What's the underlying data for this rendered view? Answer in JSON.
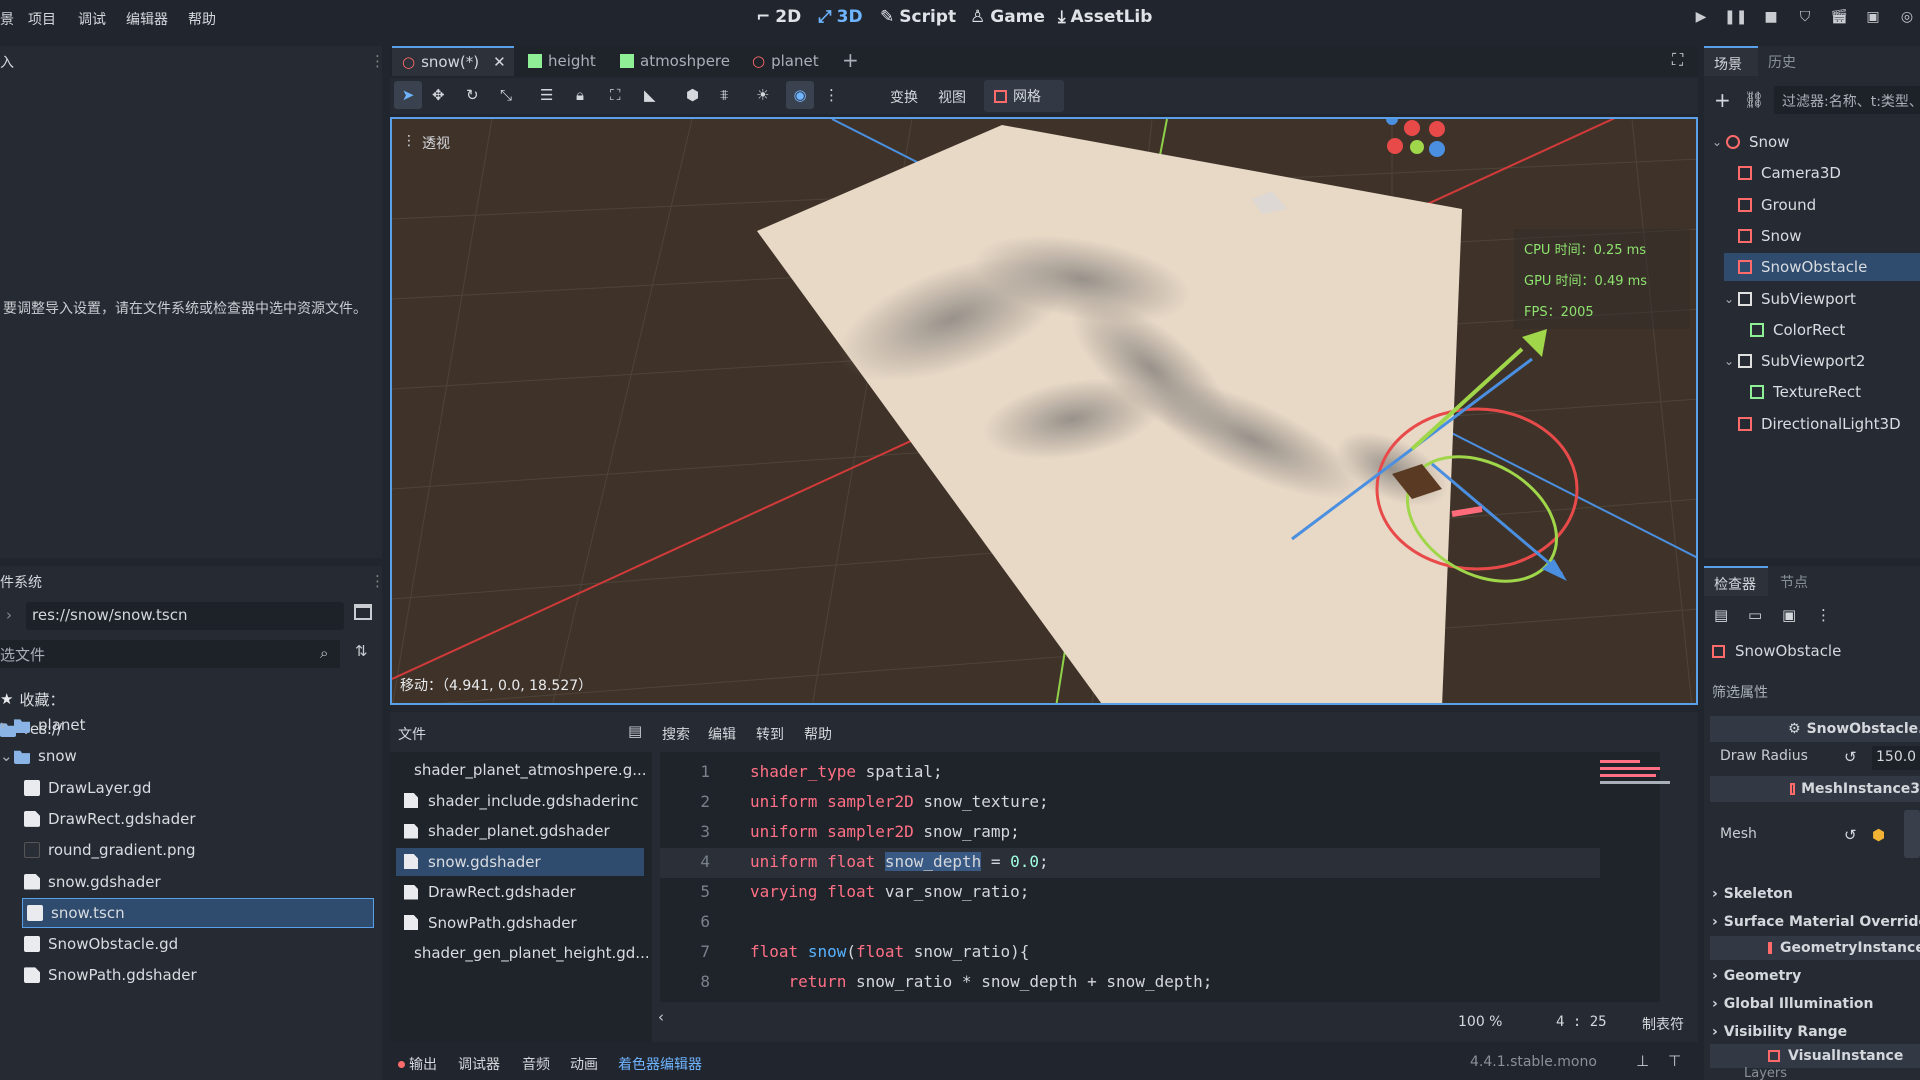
{
  "menu": [
    "景",
    "项目",
    "调试",
    "编辑器",
    "帮助"
  ],
  "modes": [
    {
      "label": "2D",
      "icon": "2d-icon"
    },
    {
      "label": "3D",
      "icon": "3d-icon"
    },
    {
      "label": "Script",
      "icon": "script-icon"
    },
    {
      "label": "Game",
      "icon": "game-icon"
    },
    {
      "label": "AssetLib",
      "icon": "assetlib-icon"
    }
  ],
  "left_dock": {
    "import_tab": "入",
    "import_message": "要调整导入设置，请在文件系统或检查器中选中资源文件。",
    "fs_tab": "件系统",
    "path": "res://snow/snow.tscn",
    "filter_placeholder": "选文件",
    "favorites": "收藏：",
    "root": "res://",
    "items": [
      {
        "name": "planet",
        "type": "folder",
        "indent": 1
      },
      {
        "name": "snow",
        "type": "folder",
        "indent": 1
      },
      {
        "name": "DrawLayer.gd",
        "type": "gear",
        "indent": 2
      },
      {
        "name": "DrawRect.gdshader",
        "type": "doc",
        "indent": 2
      },
      {
        "name": "round_gradient.png",
        "type": "img",
        "indent": 2
      },
      {
        "name": "snow.gdshader",
        "type": "doc",
        "indent": 2
      },
      {
        "name": "snow.tscn",
        "type": "scene",
        "indent": 2,
        "selected": true
      },
      {
        "name": "SnowObstacle.gd",
        "type": "gear",
        "indent": 2
      },
      {
        "name": "SnowPath.gdshader",
        "type": "doc",
        "indent": 2
      }
    ]
  },
  "scene_tabs": [
    {
      "label": "snow(*)",
      "active": true
    },
    {
      "label": "height"
    },
    {
      "label": "atmoshpere"
    },
    {
      "label": "planet"
    }
  ],
  "toolbar": {
    "transform": "变换",
    "view": "视图",
    "grid": "网格"
  },
  "viewport": {
    "perspective": "透视",
    "gpu_time": "CPU 时间：0.25 ms",
    "gpu_time2": "GPU 时间：0.49 ms",
    "fps": "FPS：2005",
    "move": "移动：（4.941, 0.0, 18.527）"
  },
  "scene_panel": {
    "tab_scene": "场景",
    "tab_history": "历史",
    "filter_placeholder": "过滤器:名称、t:类型、",
    "nodes": [
      {
        "name": "Snow",
        "color": "#ff6b6b",
        "indent": 0
      },
      {
        "name": "Camera3D",
        "color": "#ff6b6b",
        "indent": 1
      },
      {
        "name": "Ground",
        "color": "#ff6b6b",
        "indent": 1
      },
      {
        "name": "Snow",
        "color": "#ff6b6b",
        "indent": 1
      },
      {
        "name": "SnowObstacle",
        "color": "#ff6b6b",
        "indent": 1,
        "selected": true
      },
      {
        "name": "SubViewport",
        "color": "#e0e0e0",
        "indent": 1
      },
      {
        "name": "ColorRect",
        "color": "#8eef97",
        "indent": 2
      },
      {
        "name": "SubViewport2",
        "color": "#e0e0e0",
        "indent": 1
      },
      {
        "name": "TextureRect",
        "color": "#8eef97",
        "indent": 2
      },
      {
        "name": "DirectionalLight3D",
        "color": "#ff6b6b",
        "indent": 1
      }
    ]
  },
  "inspector": {
    "tab_inspector": "检查器",
    "tab_node": "节点",
    "node_name": "SnowObstacle",
    "filter": "筛选属性",
    "script_header": "SnowObstacle.",
    "draw_radius_label": "Draw Radius",
    "draw_radius_value": "150.0",
    "mesh_instance": "MeshInstance3",
    "mesh_label": "Mesh",
    "sections": [
      "Skeleton",
      "Surface Material Override",
      "GeometryInstance",
      "Geometry",
      "Global Illumination",
      "Visibility Range",
      "VisualInstance"
    ],
    "layers": "Layers"
  },
  "script_editor": {
    "menu": [
      "文件",
      "搜索",
      "编辑",
      "转到",
      "帮助"
    ],
    "files": [
      "shader_planet_atmoshpere.g...",
      "shader_include.gdshaderinc",
      "shader_planet.gdshader",
      "snow.gdshader",
      "DrawRect.gdshader",
      "SnowPath.gdshader",
      "shader_gen_planet_height.gd..."
    ],
    "selected_file": 3,
    "zoom": "100 %",
    "cursor": "4 :  25",
    "indent_mode": "制表符"
  },
  "bottom_bar": {
    "tabs": [
      "输出",
      "调试器",
      "音频",
      "动画",
      "着色器编辑器"
    ],
    "version": "4.4.1.stable.mono"
  },
  "colors": {
    "accent": "#5aa0e8",
    "keyword": "#ff7085",
    "type": "#8fffdb",
    "function": "#57b3ff"
  }
}
